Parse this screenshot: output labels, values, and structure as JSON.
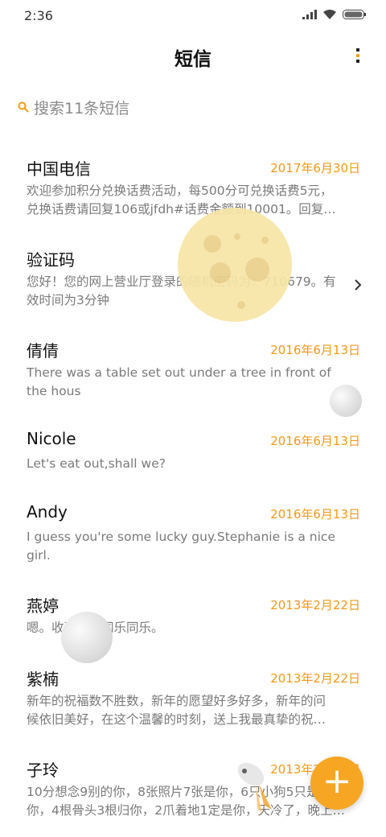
{
  "status_bar": {
    "time": "2:36"
  },
  "header": {
    "title": "短信",
    "menu_icon": "more-vertical-icon"
  },
  "search": {
    "placeholder": "搜索11条短信",
    "icon": "search-icon"
  },
  "colors": {
    "accent": "#f09a1a",
    "fab": "#f6a623"
  },
  "messages": [
    {
      "name": "中国电信",
      "date": "2017年6月30日",
      "line1": "欢迎参加积分兑换话费活动，每500分可兑换话费5元，",
      "line2": "兑换话费请回复106或jfdh#话费金额到10001。回复…"
    },
    {
      "name": "验证码",
      "date": "",
      "line1": "您好！您的网上营业厅登录的随机密码为：710679。有",
      "line2": "效时间为3分钟"
    },
    {
      "name": "倩倩",
      "date": "2016年6月13日",
      "line1": "There was a table set out under a tree in front of",
      "line2": "the hous"
    },
    {
      "name": "Nicole",
      "date": "2016年6月13日",
      "line1": "Let's eat out,shall we?",
      "line2": ""
    },
    {
      "name": "Andy",
      "date": "2016年6月13日",
      "line1": "I guess you're some lucky guy.Stephanie is a nice",
      "line2": "girl."
    },
    {
      "name": "燕婷",
      "date": "2013年2月22日",
      "line1": "嗯。收到啦。同乐同乐。",
      "line2": ""
    },
    {
      "name": "紫楠",
      "date": "2013年2月22日",
      "line1": "新年的祝福数不胜数，新年的愿望好多好多，新年的问",
      "line2": "候依旧美好，在这个温馨的时刻，送上我最真挚的祝…"
    },
    {
      "name": "子玲",
      "date": "2013年2月22日",
      "line1": "10分想念9别的你，8张照片7张是你，6只小狗5只是",
      "line2": "你，4根骨头3根归你，2爪着地1定是你，天冷了，晚上…"
    }
  ],
  "fab": {
    "icon": "plus-icon"
  }
}
